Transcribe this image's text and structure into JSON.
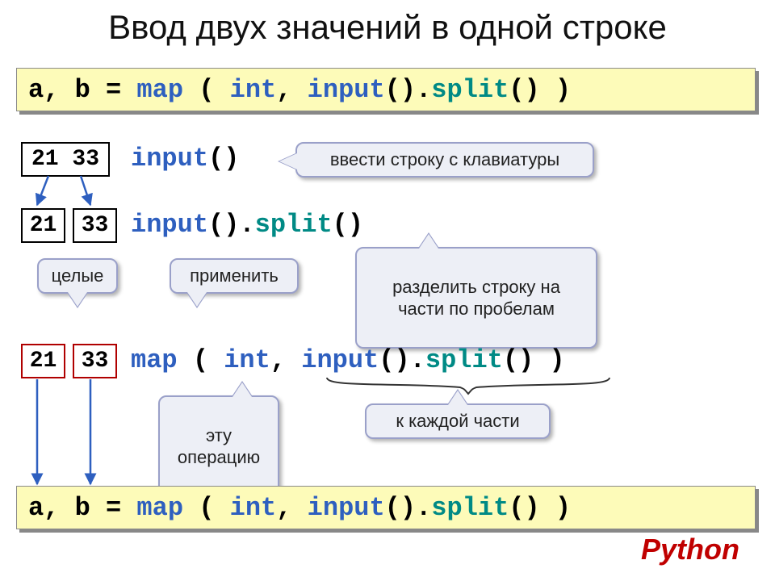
{
  "title": "Ввод двух значений в одной строке",
  "code_main_parts": {
    "lhs": "a, b = ",
    "map": "map",
    "lp": " ( ",
    "int": "int",
    "comma": ", ",
    "input": "input",
    "paren1": "().",
    "split": "split",
    "paren2": "() )"
  },
  "row1": {
    "box": "21 33",
    "input": "input",
    "paren": "()"
  },
  "row2": {
    "box_a": "21",
    "box_b": "33",
    "input": "input",
    "paren1": "().",
    "split": "split",
    "paren2": "()"
  },
  "row3": {
    "box_a": "21",
    "box_b": "33",
    "map": "map",
    "lp": " ( ",
    "int": "int",
    "comma": ", ",
    "input": "input",
    "paren1": "().",
    "split": "split",
    "paren2": "() )"
  },
  "callouts": {
    "kb": "ввести строку с клавиатуры",
    "ints": "целые",
    "apply": "применить",
    "split": "разделить строку на\nчасти по пробелам",
    "op": "эту\nоперацию",
    "each": "к каждой части"
  },
  "python_tag": "Python"
}
